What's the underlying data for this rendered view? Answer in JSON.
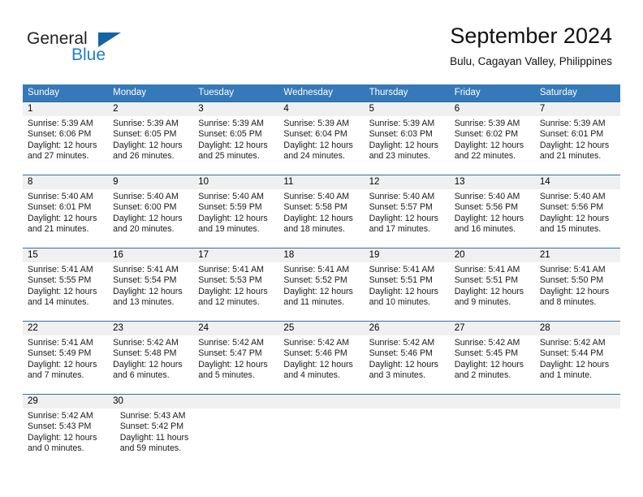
{
  "brand": {
    "name_part1": "General",
    "name_part2": "Blue",
    "logo_icon": "triangle-mark"
  },
  "header": {
    "title": "September 2024",
    "subtitle": "Bulu, Cagayan Valley, Philippines"
  },
  "colors": {
    "header_blue": "#3579b8",
    "row_divider_blue": "#2f6fab",
    "daynum_band": "#f0f0f0",
    "brand_blue": "#1f7fc4",
    "logo_mark": "#1464a5"
  },
  "weekdays": [
    "Sunday",
    "Monday",
    "Tuesday",
    "Wednesday",
    "Thursday",
    "Friday",
    "Saturday"
  ],
  "weeks": [
    {
      "days": [
        {
          "num": "1",
          "sunrise": "Sunrise: 5:39 AM",
          "sunset": "Sunset: 6:06 PM",
          "daylight1": "Daylight: 12 hours",
          "daylight2": "and 27 minutes."
        },
        {
          "num": "2",
          "sunrise": "Sunrise: 5:39 AM",
          "sunset": "Sunset: 6:05 PM",
          "daylight1": "Daylight: 12 hours",
          "daylight2": "and 26 minutes."
        },
        {
          "num": "3",
          "sunrise": "Sunrise: 5:39 AM",
          "sunset": "Sunset: 6:05 PM",
          "daylight1": "Daylight: 12 hours",
          "daylight2": "and 25 minutes."
        },
        {
          "num": "4",
          "sunrise": "Sunrise: 5:39 AM",
          "sunset": "Sunset: 6:04 PM",
          "daylight1": "Daylight: 12 hours",
          "daylight2": "and 24 minutes."
        },
        {
          "num": "5",
          "sunrise": "Sunrise: 5:39 AM",
          "sunset": "Sunset: 6:03 PM",
          "daylight1": "Daylight: 12 hours",
          "daylight2": "and 23 minutes."
        },
        {
          "num": "6",
          "sunrise": "Sunrise: 5:39 AM",
          "sunset": "Sunset: 6:02 PM",
          "daylight1": "Daylight: 12 hours",
          "daylight2": "and 22 minutes."
        },
        {
          "num": "7",
          "sunrise": "Sunrise: 5:39 AM",
          "sunset": "Sunset: 6:01 PM",
          "daylight1": "Daylight: 12 hours",
          "daylight2": "and 21 minutes."
        }
      ]
    },
    {
      "days": [
        {
          "num": "8",
          "sunrise": "Sunrise: 5:40 AM",
          "sunset": "Sunset: 6:01 PM",
          "daylight1": "Daylight: 12 hours",
          "daylight2": "and 21 minutes."
        },
        {
          "num": "9",
          "sunrise": "Sunrise: 5:40 AM",
          "sunset": "Sunset: 6:00 PM",
          "daylight1": "Daylight: 12 hours",
          "daylight2": "and 20 minutes."
        },
        {
          "num": "10",
          "sunrise": "Sunrise: 5:40 AM",
          "sunset": "Sunset: 5:59 PM",
          "daylight1": "Daylight: 12 hours",
          "daylight2": "and 19 minutes."
        },
        {
          "num": "11",
          "sunrise": "Sunrise: 5:40 AM",
          "sunset": "Sunset: 5:58 PM",
          "daylight1": "Daylight: 12 hours",
          "daylight2": "and 18 minutes."
        },
        {
          "num": "12",
          "sunrise": "Sunrise: 5:40 AM",
          "sunset": "Sunset: 5:57 PM",
          "daylight1": "Daylight: 12 hours",
          "daylight2": "and 17 minutes."
        },
        {
          "num": "13",
          "sunrise": "Sunrise: 5:40 AM",
          "sunset": "Sunset: 5:56 PM",
          "daylight1": "Daylight: 12 hours",
          "daylight2": "and 16 minutes."
        },
        {
          "num": "14",
          "sunrise": "Sunrise: 5:40 AM",
          "sunset": "Sunset: 5:56 PM",
          "daylight1": "Daylight: 12 hours",
          "daylight2": "and 15 minutes."
        }
      ]
    },
    {
      "days": [
        {
          "num": "15",
          "sunrise": "Sunrise: 5:41 AM",
          "sunset": "Sunset: 5:55 PM",
          "daylight1": "Daylight: 12 hours",
          "daylight2": "and 14 minutes."
        },
        {
          "num": "16",
          "sunrise": "Sunrise: 5:41 AM",
          "sunset": "Sunset: 5:54 PM",
          "daylight1": "Daylight: 12 hours",
          "daylight2": "and 13 minutes."
        },
        {
          "num": "17",
          "sunrise": "Sunrise: 5:41 AM",
          "sunset": "Sunset: 5:53 PM",
          "daylight1": "Daylight: 12 hours",
          "daylight2": "and 12 minutes."
        },
        {
          "num": "18",
          "sunrise": "Sunrise: 5:41 AM",
          "sunset": "Sunset: 5:52 PM",
          "daylight1": "Daylight: 12 hours",
          "daylight2": "and 11 minutes."
        },
        {
          "num": "19",
          "sunrise": "Sunrise: 5:41 AM",
          "sunset": "Sunset: 5:51 PM",
          "daylight1": "Daylight: 12 hours",
          "daylight2": "and 10 minutes."
        },
        {
          "num": "20",
          "sunrise": "Sunrise: 5:41 AM",
          "sunset": "Sunset: 5:51 PM",
          "daylight1": "Daylight: 12 hours",
          "daylight2": "and 9 minutes."
        },
        {
          "num": "21",
          "sunrise": "Sunrise: 5:41 AM",
          "sunset": "Sunset: 5:50 PM",
          "daylight1": "Daylight: 12 hours",
          "daylight2": "and 8 minutes."
        }
      ]
    },
    {
      "days": [
        {
          "num": "22",
          "sunrise": "Sunrise: 5:41 AM",
          "sunset": "Sunset: 5:49 PM",
          "daylight1": "Daylight: 12 hours",
          "daylight2": "and 7 minutes."
        },
        {
          "num": "23",
          "sunrise": "Sunrise: 5:42 AM",
          "sunset": "Sunset: 5:48 PM",
          "daylight1": "Daylight: 12 hours",
          "daylight2": "and 6 minutes."
        },
        {
          "num": "24",
          "sunrise": "Sunrise: 5:42 AM",
          "sunset": "Sunset: 5:47 PM",
          "daylight1": "Daylight: 12 hours",
          "daylight2": "and 5 minutes."
        },
        {
          "num": "25",
          "sunrise": "Sunrise: 5:42 AM",
          "sunset": "Sunset: 5:46 PM",
          "daylight1": "Daylight: 12 hours",
          "daylight2": "and 4 minutes."
        },
        {
          "num": "26",
          "sunrise": "Sunrise: 5:42 AM",
          "sunset": "Sunset: 5:46 PM",
          "daylight1": "Daylight: 12 hours",
          "daylight2": "and 3 minutes."
        },
        {
          "num": "27",
          "sunrise": "Sunrise: 5:42 AM",
          "sunset": "Sunset: 5:45 PM",
          "daylight1": "Daylight: 12 hours",
          "daylight2": "and 2 minutes."
        },
        {
          "num": "28",
          "sunrise": "Sunrise: 5:42 AM",
          "sunset": "Sunset: 5:44 PM",
          "daylight1": "Daylight: 12 hours",
          "daylight2": "and 1 minute."
        }
      ]
    },
    {
      "days": [
        {
          "num": "29",
          "sunrise": "Sunrise: 5:42 AM",
          "sunset": "Sunset: 5:43 PM",
          "daylight1": "Daylight: 12 hours",
          "daylight2": "and 0 minutes."
        },
        {
          "num": "30",
          "sunrise": "Sunrise: 5:43 AM",
          "sunset": "Sunset: 5:42 PM",
          "daylight1": "Daylight: 11 hours",
          "daylight2": "and 59 minutes."
        },
        {
          "num": "",
          "sunrise": "",
          "sunset": "",
          "daylight1": "",
          "daylight2": ""
        },
        {
          "num": "",
          "sunrise": "",
          "sunset": "",
          "daylight1": "",
          "daylight2": ""
        },
        {
          "num": "",
          "sunrise": "",
          "sunset": "",
          "daylight1": "",
          "daylight2": ""
        },
        {
          "num": "",
          "sunrise": "",
          "sunset": "",
          "daylight1": "",
          "daylight2": ""
        },
        {
          "num": "",
          "sunrise": "",
          "sunset": "",
          "daylight1": "",
          "daylight2": ""
        }
      ]
    }
  ]
}
